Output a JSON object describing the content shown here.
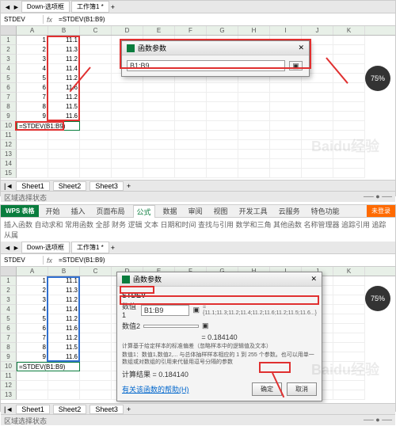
{
  "common": {
    "namebox": "STDEV",
    "formula": "=STDEV(B1:B9)",
    "col_headers": [
      "A",
      "B",
      "C",
      "D",
      "E",
      "F",
      "G",
      "H",
      "I",
      "J",
      "K"
    ],
    "row_labels": [
      "1",
      "2",
      "3",
      "4",
      "5",
      "6",
      "7",
      "8",
      "9"
    ],
    "col_a": [
      "1",
      "2",
      "3",
      "4",
      "5",
      "6",
      "7",
      "8",
      "9"
    ],
    "col_b": [
      "11.1",
      "11.3",
      "11.2",
      "11.4",
      "11.2",
      "11.6",
      "11.2",
      "11.5",
      "11.6"
    ],
    "formula_cell": "=STDEV(B1:B9)",
    "sheet_tabs": [
      "Sheet1",
      "Sheet2",
      "Sheet3"
    ],
    "zoom": "75%",
    "statusbar": "区域选择状态"
  },
  "top": {
    "tabs_left": "Down-选项框",
    "doc_tab": "工作簿1 *",
    "dialog": {
      "title": "函数参数",
      "field": "B1:B9"
    },
    "watermark": "Baidu经验"
  },
  "bottom": {
    "wps": "WPS 表格",
    "ribbon_tabs": [
      "开始",
      "插入",
      "页面布局",
      "公式",
      "数据",
      "审阅",
      "视图",
      "开发工具",
      "云服务",
      "特色功能"
    ],
    "ribbon_active": "公式",
    "ribbon_items": "插入函数 自动求和 常用函数 全部 财务 逻辑 文本 日期和时间 查找与引用 数学和三角 其他函数 名称管理器 追踪引用 追踪从属",
    "orange": "未登录",
    "tabs_left": "Down-选项框",
    "doc_tab": "工作簿1 *",
    "dialog": {
      "title": "函数参数",
      "func": "STDEV",
      "label_num": "数值1",
      "val_num": "B1:B9",
      "label_num2": "数值2",
      "preview_nums": "= {11.1;11.3;11.2;11.4;11.2;11.6;11.2;11.5;11.6...}",
      "result_eq": "= 0.184140",
      "desc1": "计算基于给定样本的标准偏差（忽略样本中的逻辑值及文本）",
      "desc2": "数值1：数值1,数值2,... 与总体抽样样本相应的 1 到 255 个参数。也可以用单一数组或对数组的引用来代替用逗号分隔的参数",
      "calc_label": "计算结果 =",
      "calc_val": "0.184140",
      "help": "有关该函数的帮助(H)",
      "ok": "确定",
      "cancel": "取消"
    },
    "watermark": "Baidu经验"
  }
}
